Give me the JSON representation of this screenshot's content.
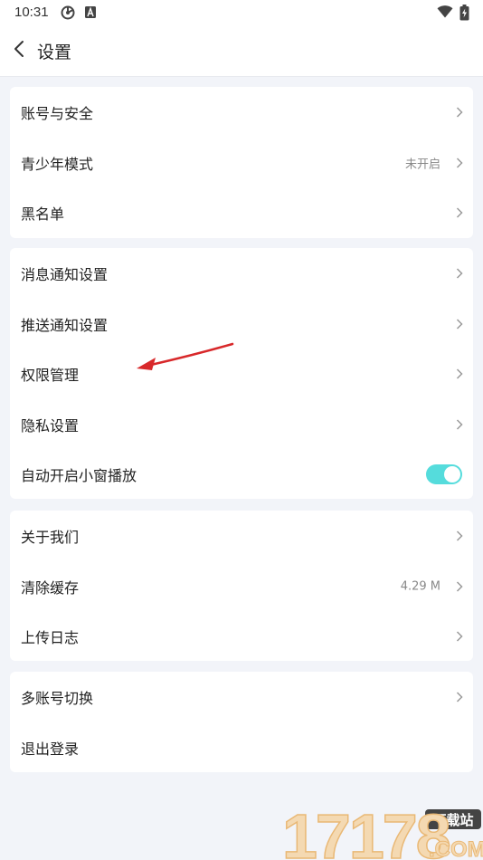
{
  "status_bar": {
    "time": "10:31",
    "icons": [
      "sync-icon",
      "a-badge-icon",
      "wifi-icon",
      "battery-charging-icon"
    ]
  },
  "header": {
    "title": "设置",
    "back_icon": "chevron-left-icon"
  },
  "groups": [
    {
      "items": [
        {
          "label": "账号与安全",
          "value": "",
          "control": "chevron"
        },
        {
          "label": "青少年模式",
          "value": "未开启",
          "control": "chevron"
        },
        {
          "label": "黑名单",
          "value": "",
          "control": "chevron"
        }
      ]
    },
    {
      "items": [
        {
          "label": "消息通知设置",
          "value": "",
          "control": "chevron"
        },
        {
          "label": "推送通知设置",
          "value": "",
          "control": "chevron"
        },
        {
          "label": "权限管理",
          "value": "",
          "control": "chevron"
        },
        {
          "label": "隐私设置",
          "value": "",
          "control": "chevron"
        },
        {
          "label": "自动开启小窗播放",
          "value": "",
          "control": "toggle",
          "toggle_on": true
        }
      ]
    },
    {
      "items": [
        {
          "label": "关于我们",
          "value": "",
          "control": "chevron"
        },
        {
          "label": "清除缓存",
          "value": "4.29 M",
          "control": "chevron"
        },
        {
          "label": "上传日志",
          "value": "",
          "control": "chevron"
        }
      ]
    },
    {
      "items": [
        {
          "label": "多账号切换",
          "value": "",
          "control": "chevron"
        },
        {
          "label": "退出登录",
          "value": "",
          "control": "none"
        }
      ]
    }
  ],
  "annotation": {
    "type": "red-arrow",
    "color": "#d8282a"
  },
  "watermark": {
    "brand": "17178",
    "badge": "下载站",
    "domain": ".COM"
  },
  "colors": {
    "background": "#f2f4f9",
    "card": "#ffffff",
    "toggle_on": "#55dcdc",
    "muted_text": "#888888"
  }
}
